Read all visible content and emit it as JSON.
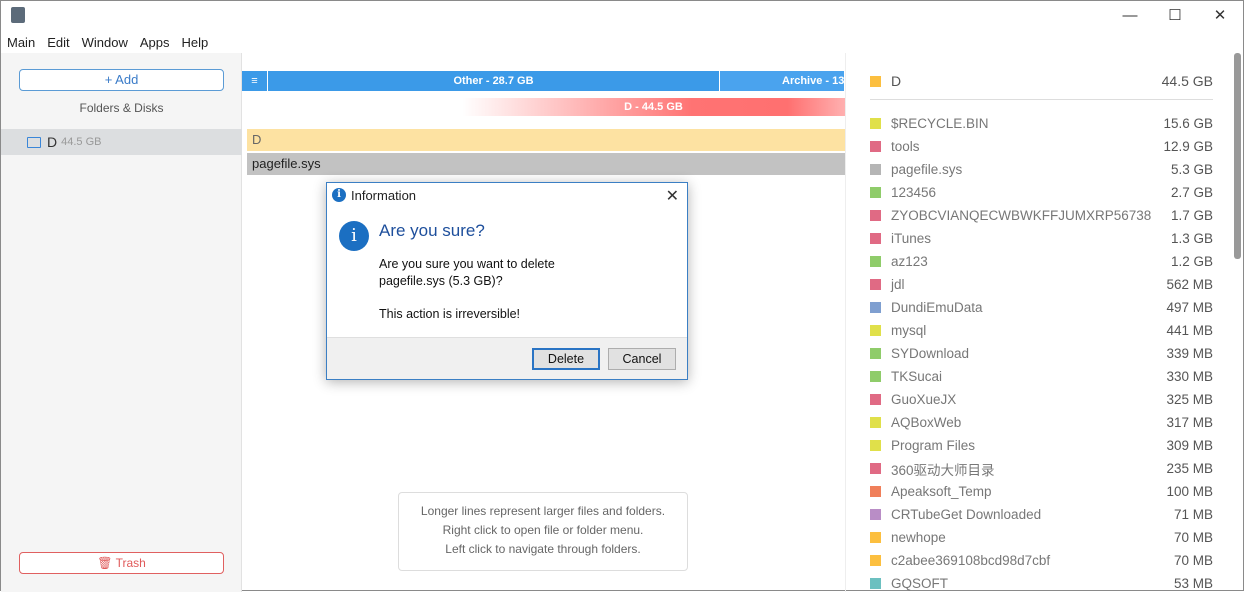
{
  "window": {
    "minimize": "—",
    "maximize": "☐",
    "close": "✕"
  },
  "menu": [
    "Main",
    "Edit",
    "Window",
    "Apps",
    "Help"
  ],
  "sidebar": {
    "add_label": "+ Add",
    "section_label": "Folders & Disks",
    "disk": {
      "name": "D",
      "size": "44.5 GB"
    },
    "trash_label": "Trash"
  },
  "main": {
    "menu_icon": "≡",
    "segments": [
      {
        "label": "Other - 28.7 GB",
        "color": "#3b9ae8"
      },
      {
        "label": "Archive - 13",
        "color": "#4aa3ee"
      }
    ],
    "disk_bar": "D - 44.5 GB",
    "rows": [
      "D",
      "pagefile.sys"
    ],
    "hint": [
      "Longer lines represent larger files and folders.",
      "Right click to open file or folder menu.",
      "Left click to navigate through folders."
    ]
  },
  "right": {
    "header": {
      "name": "D",
      "size": "44.5 GB",
      "color": "#fcbf3f"
    },
    "items": [
      {
        "name": "$RECYCLE.BIN",
        "size": "15.6 GB",
        "color": "#e0e04a"
      },
      {
        "name": "tools",
        "size": "12.9 GB",
        "color": "#e06a84"
      },
      {
        "name": "pagefile.sys",
        "size": "5.3 GB",
        "color": "#b5b5b5"
      },
      {
        "name": "123456",
        "size": "2.7 GB",
        "color": "#8fcc6a"
      },
      {
        "name": "ZYOBCVIANQECWBWKFFJUMXRP56738",
        "size": "1.7 GB",
        "color": "#e06a84"
      },
      {
        "name": "iTunes",
        "size": "1.3 GB",
        "color": "#e06a84"
      },
      {
        "name": "az123",
        "size": "1.2 GB",
        "color": "#8fcc6a"
      },
      {
        "name": "jdl",
        "size": "562 MB",
        "color": "#e06a84"
      },
      {
        "name": "DundiEmuData",
        "size": "497 MB",
        "color": "#7f9fd0"
      },
      {
        "name": "mysql",
        "size": "441 MB",
        "color": "#e0e04a"
      },
      {
        "name": "SYDownload",
        "size": "339 MB",
        "color": "#8fcc6a"
      },
      {
        "name": "TKSucai",
        "size": "330 MB",
        "color": "#8fcc6a"
      },
      {
        "name": "GuoXueJX",
        "size": "325 MB",
        "color": "#e06a84"
      },
      {
        "name": "AQBoxWeb",
        "size": "317 MB",
        "color": "#e0e04a"
      },
      {
        "name": "Program Files",
        "size": "309 MB",
        "color": "#e0e04a"
      },
      {
        "name": "360驱动大师目录",
        "size": "235 MB",
        "color": "#e06a84"
      },
      {
        "name": "Apeaksoft_Temp",
        "size": "100 MB",
        "color": "#f07f5a"
      },
      {
        "name": "CRTubeGet Downloaded",
        "size": "71 MB",
        "color": "#b98dc6"
      },
      {
        "name": "newhope",
        "size": "70 MB",
        "color": "#fcbf3f"
      },
      {
        "name": "c2abee369108bcd98d7cbf",
        "size": "70 MB",
        "color": "#fcbf3f"
      },
      {
        "name": "GQSOFT",
        "size": "53 MB",
        "color": "#6cc0c0"
      }
    ]
  },
  "dialog": {
    "title": "Information",
    "heading": "Are you sure?",
    "message_line1": "Are you sure you want to delete",
    "message_line2": "pagefile.sys (5.3 GB)?",
    "warning": "This action is irreversible!",
    "delete_label": "Delete",
    "cancel_label": "Cancel",
    "close": "✕",
    "info_glyph": "i"
  }
}
